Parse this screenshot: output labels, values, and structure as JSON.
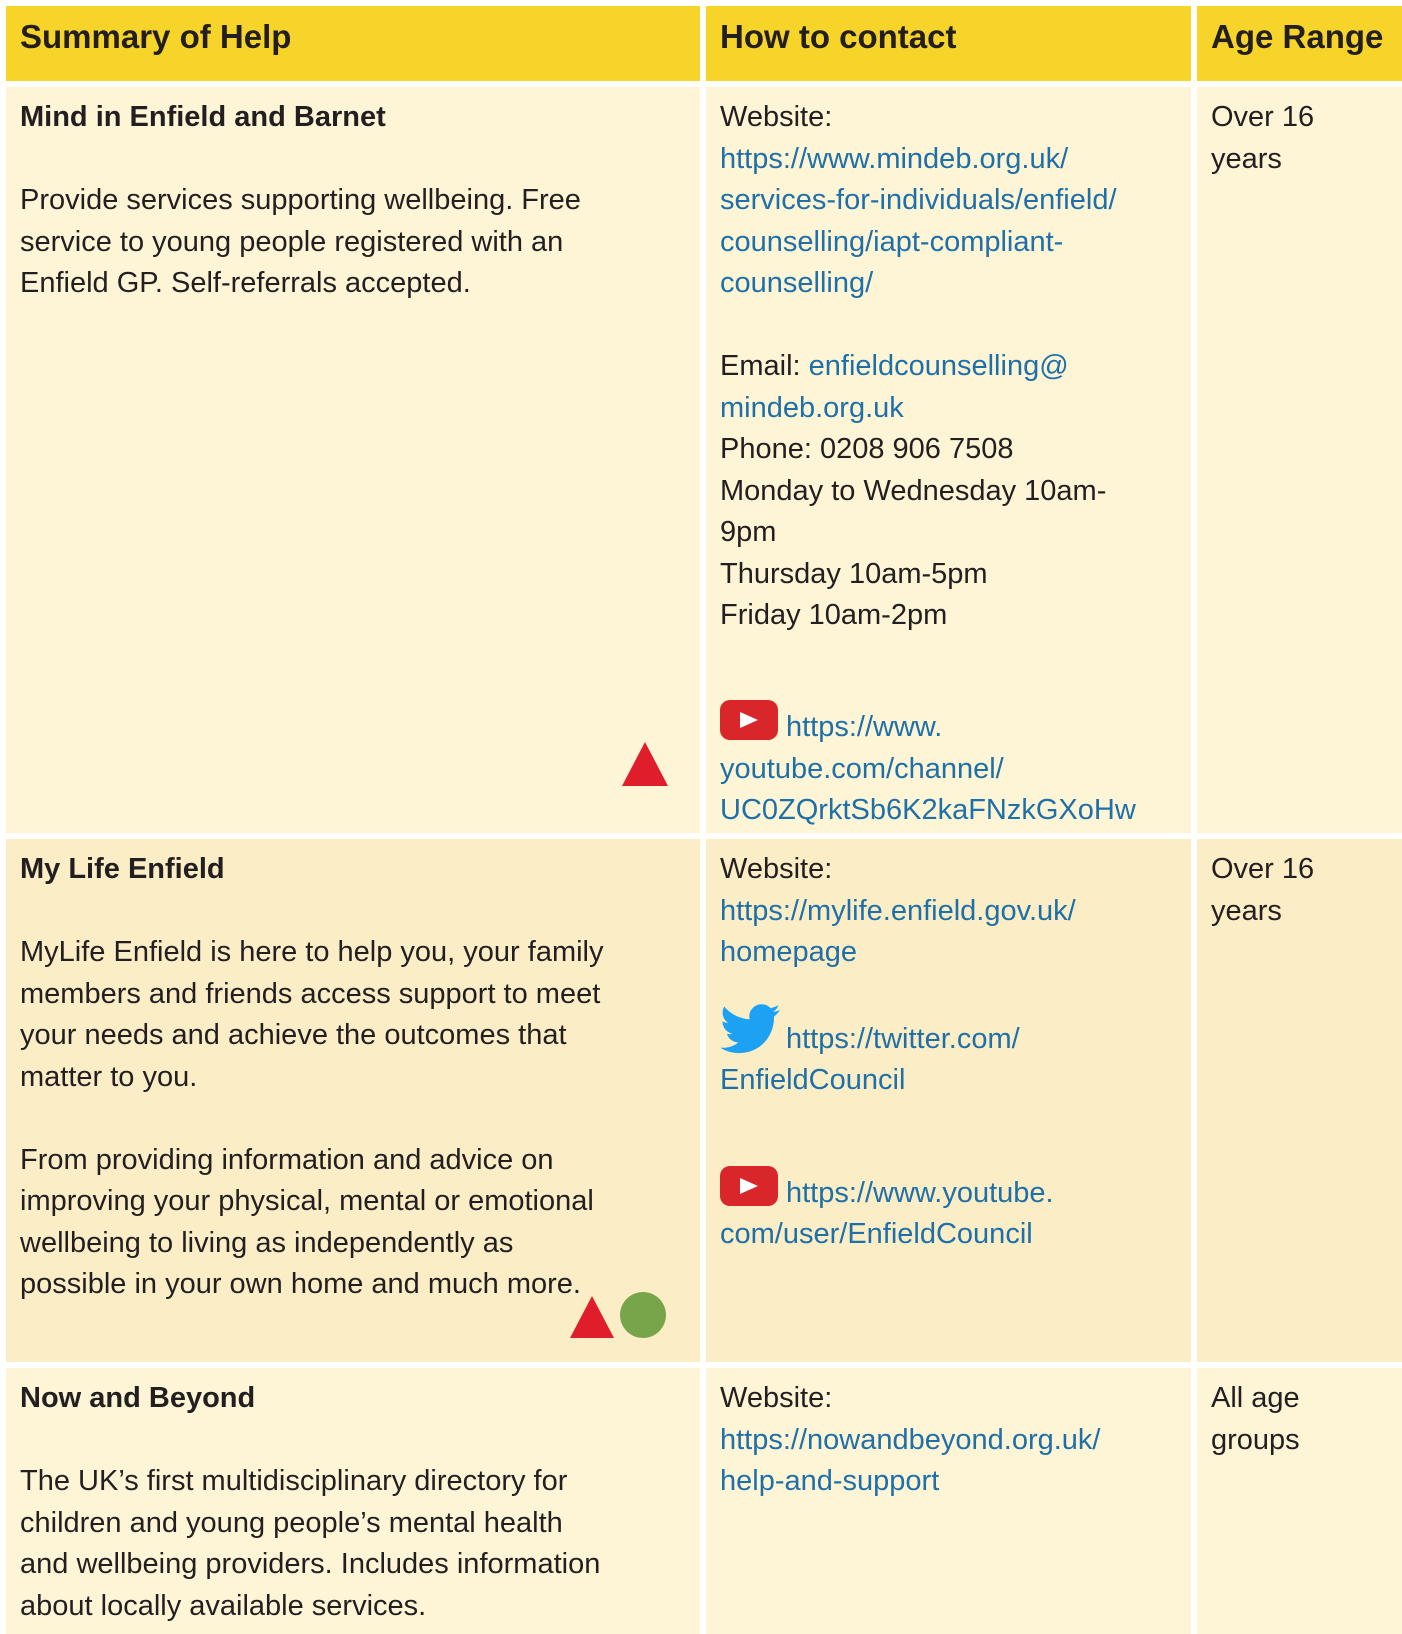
{
  "header": {
    "summary": "Summary of Help",
    "contact": "How to contact",
    "age": "Age Range"
  },
  "rows": [
    {
      "title": "Mind in Enfield and Barnet",
      "description": [
        "Provide services supporting wellbeing. Free",
        "service to young people registered with an",
        "Enfield GP. Self-referrals accepted."
      ],
      "website_label": "Website:",
      "website_url": [
        "https://www.mindeb.org.uk/",
        "services-for-individuals/enfield/",
        "counselling/iapt-compliant-",
        "counselling/"
      ],
      "email_label": "Email: ",
      "email": [
        "enfieldcounselling@",
        "mindeb.org.uk"
      ],
      "phone": "Phone: 0208 906 7508",
      "hours": [
        "Monday to Wednesday 10am-",
        "9pm",
        "Thursday 10am-5pm",
        "Friday 10am-2pm"
      ],
      "youtube_url": [
        "https://www.",
        "youtube.com/channel/",
        "UC0ZQrktSb6K2kaFNzkGXoHw"
      ],
      "age": [
        "Over 16",
        "years"
      ],
      "markers": [
        "red-triangle"
      ]
    },
    {
      "title": "My Life Enfield",
      "description_1": [
        "MyLife Enfield is here to help you, your family",
        "members and friends access support to meet",
        "your needs and achieve the outcomes that",
        "matter to you."
      ],
      "description_2": [
        "From providing information and advice on",
        "improving your physical, mental or emotional",
        "wellbeing to living as independently as",
        "possible in your own home and much more."
      ],
      "website_label": "Website:",
      "website_url": [
        "https://mylife.enfield.gov.uk/",
        "homepage"
      ],
      "twitter_url": [
        "https://twitter.com/",
        "EnfieldCouncil"
      ],
      "youtube_url": [
        "https://www.youtube.",
        "com/user/EnfieldCouncil"
      ],
      "age": [
        "Over 16",
        "years"
      ],
      "markers": [
        "red-triangle",
        "green-circle"
      ]
    },
    {
      "title": "Now and Beyond",
      "description": [
        "The UK’s first multidisciplinary directory for",
        "children and young people’s mental health",
        "and wellbeing providers. Includes information",
        "about locally available services."
      ],
      "website_label": "Website:",
      "website_url": [
        "https://nowandbeyond.org.uk/",
        "help-and-support"
      ],
      "age": [
        "All age",
        "groups"
      ]
    }
  ],
  "colors": {
    "header_bg": "#f6d42a",
    "row_light": "#fdf5d6",
    "row_dark": "#fbedc6",
    "link": "#1f6fa8",
    "triangle": "#e01e2b",
    "circle": "#78a54a",
    "youtube": "#d8262b",
    "twitter": "#1da1f2"
  },
  "icons": [
    "youtube-icon",
    "twitter-icon",
    "red-triangle-icon",
    "green-circle-icon"
  ]
}
